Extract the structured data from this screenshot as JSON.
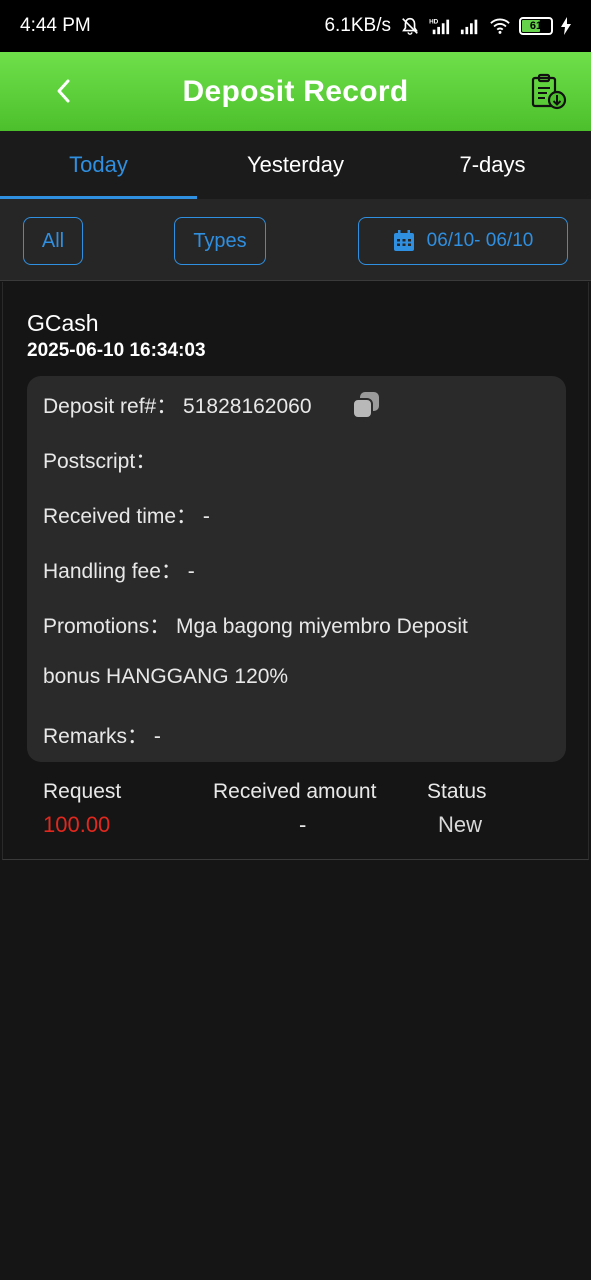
{
  "status_bar": {
    "time": "4:44 PM",
    "network_speed": "6.1KB/s",
    "battery_level": "61"
  },
  "header": {
    "title": "Deposit Record",
    "back_icon": "chevron-left-icon",
    "action_icon": "clipboard-download-icon"
  },
  "tabs": [
    {
      "label": "Today",
      "active": true
    },
    {
      "label": "Yesterday",
      "active": false
    },
    {
      "label": "7-days",
      "active": false
    }
  ],
  "filters": {
    "all_label": "All",
    "types_label": "Types",
    "date_range": "06/10- 06/10"
  },
  "record": {
    "method": "GCash",
    "datetime": "2025-06-10 16:34:03",
    "deposit_ref": "Deposit ref#： 51828162060",
    "postscript": "Postscript：",
    "received_time": "Received time： -",
    "handling_fee": "Handling fee： -",
    "promotions_line1": "Promotions： Mga bagong miyembro Deposit",
    "promotions_line2": "bonus HANGGANG 120%",
    "remarks": "Remarks： -",
    "request_label": "Request",
    "request_value": "100.00",
    "received_amount_label": "Received amount",
    "received_amount_value": "-",
    "status_label": "Status",
    "status_value": "New"
  },
  "colors": {
    "accent_blue": "#2f8fe0",
    "header_green": "#5cd03a",
    "request_red": "#e0281e"
  }
}
